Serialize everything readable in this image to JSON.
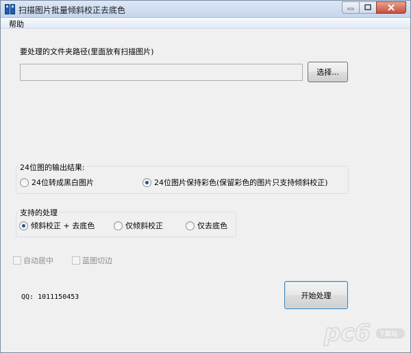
{
  "window": {
    "title": "扫描图片批量倾斜校正去底色"
  },
  "menu": {
    "help": "帮助"
  },
  "folder": {
    "label": "要处理的文件夹路径(里面放有扫描图片)",
    "value": "",
    "select_button": "选择..."
  },
  "output_group": {
    "title": "24位图的输出结果:",
    "options": [
      {
        "label": "24位转成黑白图片",
        "checked": false
      },
      {
        "label": "24位图片保持彩色(保留彩色的图片只支持倾斜校正)",
        "checked": true
      }
    ]
  },
  "processing_group": {
    "title": "支持的处理",
    "options": [
      {
        "label": "倾斜校正 + 去底色",
        "checked": true
      },
      {
        "label": "仅倾斜校正",
        "checked": false
      },
      {
        "label": "仅去底色",
        "checked": false
      }
    ]
  },
  "checkboxes": {
    "auto_center": "自动居中",
    "blue_crop": "蓝图切边"
  },
  "qq_text": "QQ: 1011150453",
  "start_button": "开始处理",
  "watermark": {
    "logo": "pc6",
    "site": "下载站"
  }
}
